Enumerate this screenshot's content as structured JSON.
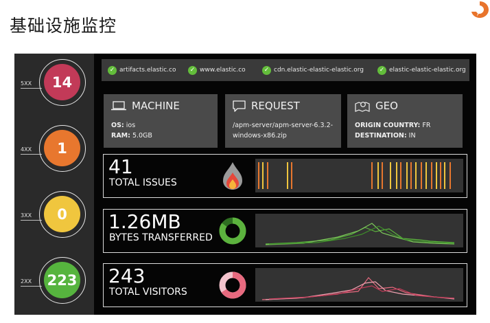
{
  "page": {
    "title": "基础设施监控"
  },
  "statuses": [
    {
      "label": "5XX",
      "value": "14",
      "color": "#c23a58"
    },
    {
      "label": "4XX",
      "value": "1",
      "color": "#e8772e"
    },
    {
      "label": "3XX",
      "value": "0",
      "color": "#f0c63e"
    },
    {
      "label": "2XX",
      "value": "223",
      "color": "#56b43e"
    }
  ],
  "urls": [
    {
      "text": "artifacts.elastic.co",
      "icon": "check-circle-icon"
    },
    {
      "text": "www.elastic.co",
      "icon": "check-circle-icon"
    },
    {
      "text": "cdn.elastic-elastic-elastic.org",
      "icon": "check-circle-icon"
    },
    {
      "text": "elastic-elastic-elastic.org",
      "icon": "check-circle-icon"
    }
  ],
  "machine": {
    "title": "MACHINE",
    "os_label": "OS:",
    "os_value": "ios",
    "ram_label": "RAM:",
    "ram_value": "5.0GB",
    "icon": "laptop-icon"
  },
  "request": {
    "title": "REQUEST",
    "line1": "/apm-server/apm-server-6.3.2-",
    "line2": "windows-x86.zip",
    "icon": "speech-bubble-icon"
  },
  "geo": {
    "title": "GEO",
    "origin_label": "ORIGIN COUNTRY:",
    "origin_value": "FR",
    "dest_label": "DESTINATION:",
    "dest_value": "IN",
    "icon": "map-pin-icon"
  },
  "metrics": [
    {
      "value": "41",
      "label": "TOTAL ISSUES",
      "icon": "flame-icon",
      "color": "#f2a03a"
    },
    {
      "value": "1.26MB",
      "label": "BYTES TRANSFERRED",
      "icon": "donut-icon",
      "color": "#5cb23e"
    },
    {
      "value": "243",
      "label": "TOTAL VISITORS",
      "icon": "donut-icon",
      "color": "#e76a7f"
    }
  ]
}
